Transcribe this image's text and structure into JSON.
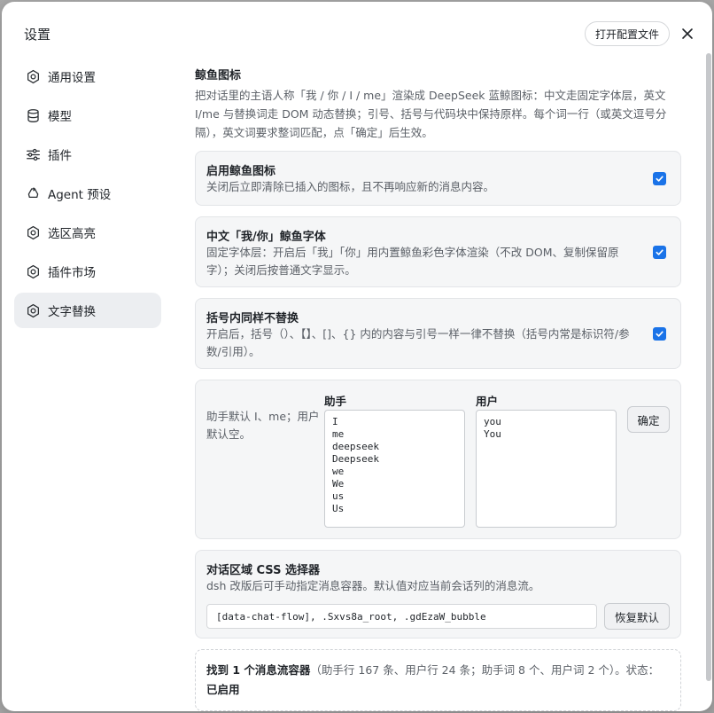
{
  "dialog": {
    "title": "设置",
    "open_config_label": "打开配置文件"
  },
  "sidebar": {
    "items": [
      {
        "label": "通用设置",
        "icon": "gear-icon",
        "active": false
      },
      {
        "label": "模型",
        "icon": "database-icon",
        "active": false
      },
      {
        "label": "插件",
        "icon": "sliders-icon",
        "active": false
      },
      {
        "label": "Agent 预设",
        "icon": "recycle-icon",
        "active": false
      },
      {
        "label": "选区高亮",
        "icon": "gear-icon",
        "active": false
      },
      {
        "label": "插件市场",
        "icon": "gear-icon",
        "active": false
      },
      {
        "label": "文字替换",
        "icon": "gear-icon",
        "active": true
      }
    ]
  },
  "section": {
    "title": "鲸鱼图标",
    "desc": "把对话里的主语人称「我 / 你 / I / me」渲染成 DeepSeek 蓝鲸图标：中文走固定字体层，英文 I/me 与替换词走 DOM 动态替换；引号、括号与代码块中保持原样。每个词一行（或英文逗号分隔），英文词要求整词匹配，点「确定」后生效。"
  },
  "options": [
    {
      "title": "启用鲸鱼图标",
      "desc": "关闭后立即清除已插入的图标，且不再响应新的消息内容。",
      "checked": true
    },
    {
      "title": "中文「我/你」鲸鱼字体",
      "desc": "固定字体层：开启后「我」「你」用内置鲸鱼彩色字体渲染（不改 DOM、复制保留原字）；关闭后按普通文字显示。",
      "checked": true
    },
    {
      "title": "括号内同样不替换",
      "desc": "开启后，括号（）、【】、[]、{} 内的内容与引号一样一律不替换（括号内常是标识符/参数/引用）。",
      "checked": true
    }
  ],
  "words": {
    "hint": "助手默认 I、me；用户默认空。",
    "assistant_label": "助手",
    "assistant_value": "I\nme\ndeepseek\nDeepseek\nwe\nWe\nus\nUs",
    "user_label": "用户",
    "user_value": "you\nYou",
    "confirm_label": "确定"
  },
  "selector": {
    "title": "对话区域 CSS 选择器",
    "desc": "dsh 改版后可手动指定消息容器。默认值对应当前会话列的消息流。",
    "value": "[data-chat-flow], .Sxvs8a_root, .gdEzaW_bubble",
    "reset_label": "恢复默认"
  },
  "status": {
    "found": "找到 1 个消息流容器",
    "detail": "（助手行 167 条、用户行 24 条；助手词 8 个、用户词 2 个）。状态：",
    "state": "已启用"
  },
  "colors": {
    "accent": "#1a73e8",
    "active_nav_bg": "#eceef1",
    "card_bg": "#f5f6f7"
  }
}
